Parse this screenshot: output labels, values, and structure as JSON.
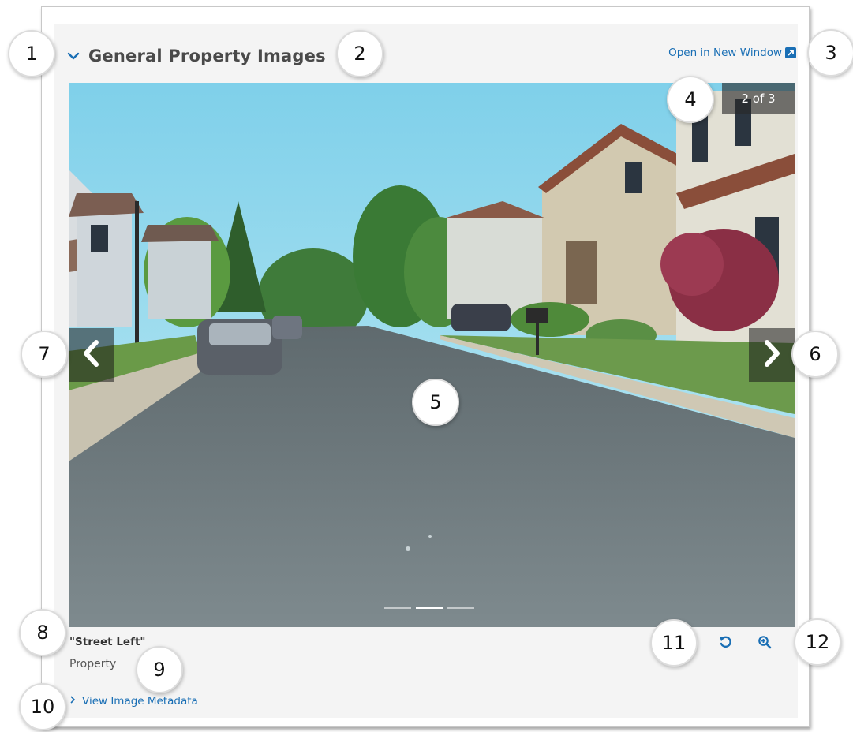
{
  "header": {
    "title": "General Property Images",
    "open_new_window_label": "Open in New Window"
  },
  "viewer": {
    "counter": "2 of 3",
    "current_index": 2,
    "total_images": 3
  },
  "image_info": {
    "caption": "\"Street Left\"",
    "category": "Property",
    "metadata_link": "View Image Metadata"
  },
  "markers": [
    "1",
    "2",
    "3",
    "4",
    "5",
    "6",
    "7",
    "8",
    "9",
    "10",
    "11",
    "12"
  ],
  "icons": {
    "collapse": "chevron-down-icon",
    "open_external": "external-link-icon",
    "previous": "chevron-left-icon",
    "next": "chevron-right-icon",
    "metadata_expand": "chevron-right-icon",
    "rotate": "rotate-icon",
    "zoom": "zoom-in-icon"
  },
  "colors": {
    "link": "#1a6fb5",
    "title": "#4a4a4a",
    "panel_background": "#f4f4f4"
  }
}
